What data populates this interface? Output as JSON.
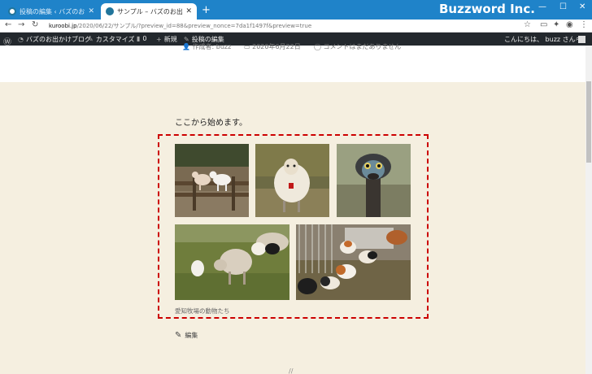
{
  "browser": {
    "tabs": [
      {
        "title": "投稿の編集 ‹ バズのお出かけブログ —",
        "active": false
      },
      {
        "title": "サンプル – バズのお出かけブログ",
        "active": true
      }
    ],
    "new_tab": "+",
    "brand": "Buzzword Inc.",
    "window_controls": [
      "—",
      "☐",
      "✕"
    ],
    "url_domain": "kuroobi.jp",
    "url_rest": "/2020/06/22/サンプル/?preview_id=88&preview_nonce=7da1f1497f&preview=true"
  },
  "admin_bar": {
    "site_name": "バズのお出かけブログ",
    "customize": "カスタマイズ",
    "comments_count": "0",
    "new": "新規",
    "edit_post": "投稿の編集",
    "greeting": "こんにちは、 buzz さん"
  },
  "post": {
    "meta_author": "作成者: buzz",
    "meta_date": "2020年6月22日",
    "meta_comments": "コメントはまだありません",
    "intro": "ここから始めます。",
    "caption": "愛知牧場の動物たち",
    "edit_label": "編集",
    "bottom_mark": "//"
  },
  "gallery": {
    "images": [
      {
        "subject": "goats on wooden fence"
      },
      {
        "subject": "sheep standing on grass"
      },
      {
        "subject": "emu head close-up"
      },
      {
        "subject": "sheep and lambs grazing"
      },
      {
        "subject": "guinea pigs in pen"
      }
    ]
  }
}
